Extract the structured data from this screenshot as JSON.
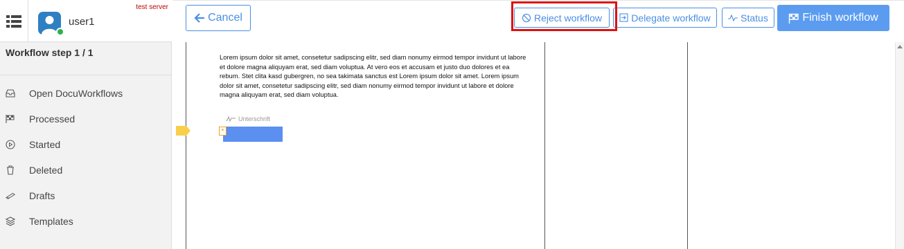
{
  "header": {
    "username": "user1",
    "server_tag": "test server",
    "menu_icon": "list-icon",
    "avatar_icon": "user-icon",
    "status_color": "#2bb24c"
  },
  "sidebar": {
    "workflow_step": "Workflow step 1 / 1",
    "items": [
      {
        "label": "Open DocuWorkflows",
        "icon": "inbox-icon"
      },
      {
        "label": "Processed",
        "icon": "flag-icon"
      },
      {
        "label": "Started",
        "icon": "play-icon"
      },
      {
        "label": "Deleted",
        "icon": "trash-icon"
      },
      {
        "label": "Drafts",
        "icon": "pencil-icon"
      },
      {
        "label": "Templates",
        "icon": "layers-icon"
      }
    ]
  },
  "toolbar": {
    "cancel_label": "Cancel",
    "reject_label": "Reject workflow",
    "delegate_label": "Delegate workflow",
    "status_label": "Status",
    "finish_label": "Finish workflow",
    "accent_color": "#4a8ee6"
  },
  "document": {
    "body_text": "Lorem ipsum dolor sit amet, consetetur sadipscing elitr, sed diam nonumy eirmod tempor invidunt ut labore et dolore magna aliquyam erat, sed diam voluptua. At vero eos et accusam et justo duo dolores et ea rebum. Stet clita kasd gubergren, no sea takimata sanctus est Lorem ipsum dolor sit amet. Lorem ipsum dolor sit amet, consetetur sadipscing elitr, sed diam nonumy eirmod tempor invidunt ut labore et dolore magna aliquyam erat, sed diam voluptua.",
    "signature_label": "Unterschrift",
    "required_marker": "*"
  }
}
